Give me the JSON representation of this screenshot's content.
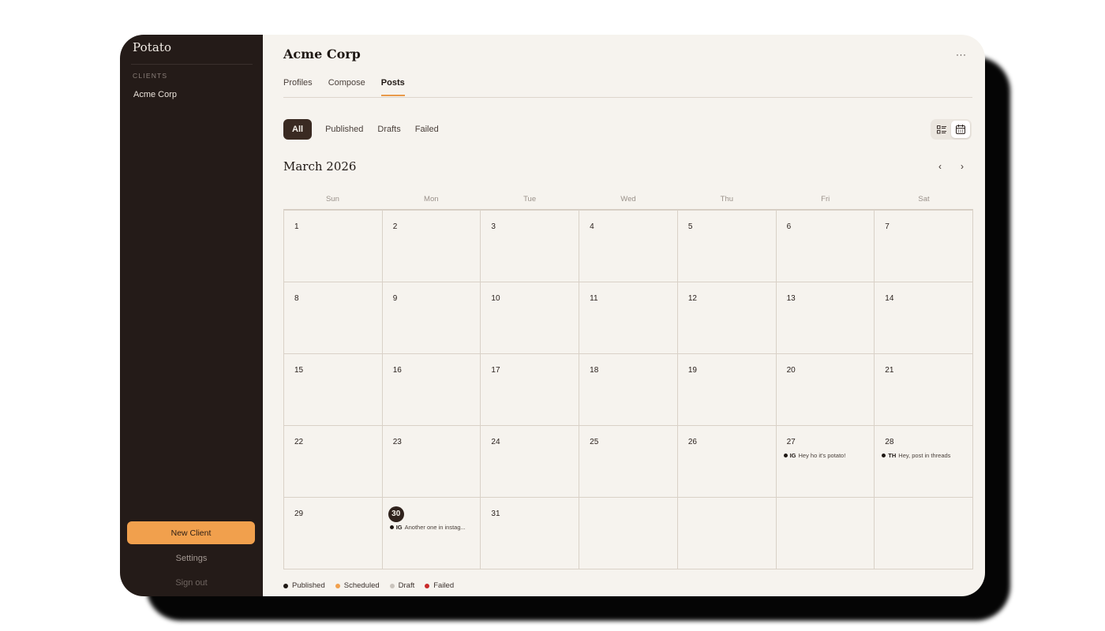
{
  "sidebar": {
    "brand": "Potato",
    "section_label": "CLIENTS",
    "clients": [
      "Acme Corp"
    ],
    "new_client_label": "New Client",
    "settings_label": "Settings",
    "signout_label": "Sign out"
  },
  "header": {
    "title": "Acme Corp",
    "more_label": "···",
    "tabs": [
      {
        "label": "Profiles",
        "active": false
      },
      {
        "label": "Compose",
        "active": false
      },
      {
        "label": "Posts",
        "active": true
      }
    ]
  },
  "filters": [
    {
      "label": "All",
      "active": true
    },
    {
      "label": "Published",
      "active": false
    },
    {
      "label": "Drafts",
      "active": false
    },
    {
      "label": "Failed",
      "active": false
    }
  ],
  "view_toggle": {
    "list_icon": "list-view-icon",
    "calendar_icon": "calendar-view-icon",
    "active": "calendar"
  },
  "calendar": {
    "month_label": "March 2026",
    "prev_label": "‹",
    "next_label": "›",
    "weekdays": [
      "Sun",
      "Mon",
      "Tue",
      "Wed",
      "Thu",
      "Fri",
      "Sat"
    ],
    "days": [
      "1",
      "2",
      "3",
      "4",
      "5",
      "6",
      "7",
      "8",
      "9",
      "10",
      "11",
      "12",
      "13",
      "14",
      "15",
      "16",
      "17",
      "18",
      "19",
      "20",
      "21",
      "22",
      "23",
      "24",
      "25",
      "26",
      "27",
      "28",
      "29",
      "30",
      "31",
      "",
      "",
      "",
      ""
    ],
    "today": "30",
    "events": [
      {
        "day": "27",
        "platform": "IG",
        "text": "Hey ho it's potato!",
        "status": "published"
      },
      {
        "day": "28",
        "platform": "TH",
        "text": "Hey, post in threads",
        "status": "published"
      },
      {
        "day": "30",
        "platform": "IG",
        "text": "Another one in instag...",
        "status": "published"
      }
    ]
  },
  "legend": [
    {
      "label": "Published",
      "color": "#1f1814"
    },
    {
      "label": "Scheduled",
      "color": "#f1a04d"
    },
    {
      "label": "Draft",
      "color": "#c9c3bc"
    },
    {
      "label": "Failed",
      "color": "#c92a2a"
    }
  ],
  "colors": {
    "accent": "#f1a04d",
    "sidebar_bg": "#241b18",
    "content_bg": "#f6f3ee"
  }
}
